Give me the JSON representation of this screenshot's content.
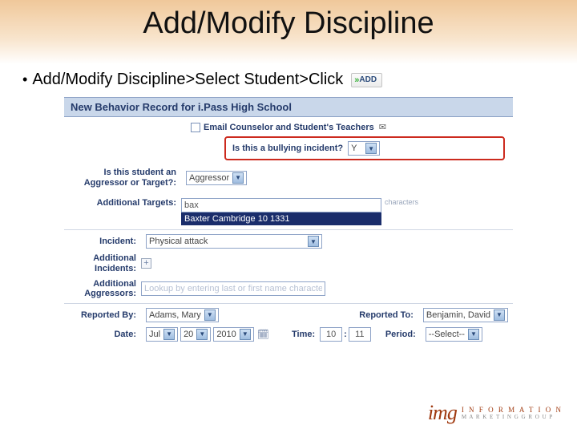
{
  "slide": {
    "title": "Add/Modify Discipline",
    "bullet": "Add/Modify Discipline>Select Student>Click",
    "add_label": "ADD"
  },
  "form": {
    "header": "New Behavior Record for i.Pass High School",
    "email_label": "Email Counselor and Student's Teachers",
    "bully": {
      "label": "Is this a bullying incident?",
      "value": "Y"
    },
    "role": {
      "label": "Is this student an Aggressor or Target?:",
      "value": "Aggressor"
    },
    "targets": {
      "label": "Additional Targets:",
      "input": "bax",
      "suggestion": "Baxter Cambridge 10 1331",
      "hint": "characters"
    },
    "incident": {
      "label": "Incident:",
      "value": "Physical attack"
    },
    "add_inc": {
      "label": "Additional Incidents:"
    },
    "add_aggr": {
      "label": "Additional Aggressors:",
      "placeholder": "Lookup by entering last or first name characters"
    },
    "reported_by": {
      "label": "Reported By:",
      "value": "Adams, Mary"
    },
    "reported_to": {
      "label": "Reported To:",
      "value": "Benjamin, David"
    },
    "date": {
      "label": "Date:",
      "month": "Jul",
      "day": "20",
      "year": "2010"
    },
    "time": {
      "label": "Time:",
      "hh": "10",
      "mm": "11"
    },
    "period": {
      "label": "Period:",
      "value": "--Select--"
    }
  },
  "branding": {
    "mark": "img",
    "line1": "I N F O R M A T I O N",
    "line2": "M A R K E T I N G  G R O U P"
  }
}
